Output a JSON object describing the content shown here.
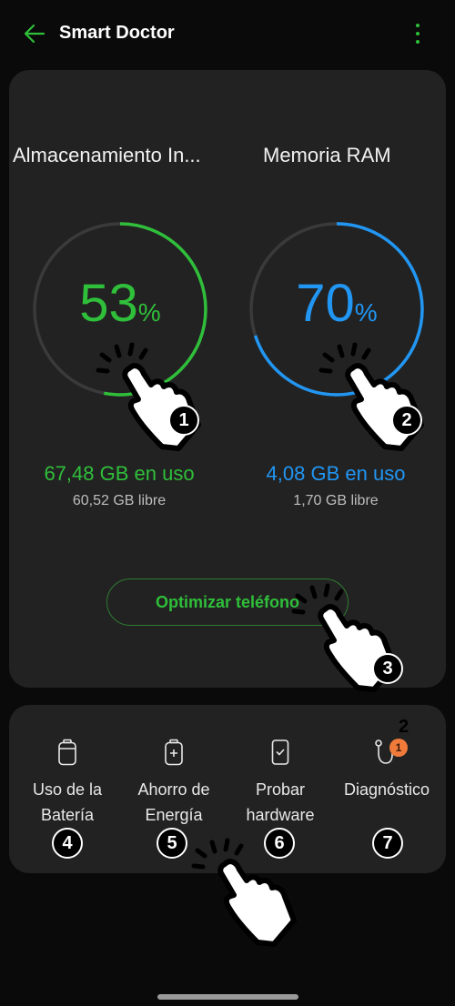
{
  "header": {
    "title": "Smart Doctor",
    "back_icon": "arrow-left-icon",
    "menu_icon": "more-vertical-icon"
  },
  "colors": {
    "accent_green": "#2fbf3a",
    "accent_blue": "#2196f3",
    "card_bg": "#222222",
    "page_bg": "#0a0a0a",
    "track": "#3a3a3a",
    "badge": "#f07a3a"
  },
  "storage": {
    "title": "Almacenamiento In...",
    "percent": "53",
    "percent_value": 53,
    "percent_symbol": "%",
    "used": "67,48 GB en uso",
    "free": "60,52 GB libre"
  },
  "ram": {
    "title": "Memoria RAM",
    "percent": "70",
    "percent_value": 70,
    "percent_symbol": "%",
    "used": "4,08 GB en uso",
    "free": "1,70 GB libre"
  },
  "optimize_button": "Optimizar teléfono",
  "tools": [
    {
      "label": "Uso de la Batería",
      "icon": "battery-icon"
    },
    {
      "label": "Ahorro de Energía",
      "icon": "battery-plus-icon"
    },
    {
      "label": "Probar hardware",
      "icon": "phone-check-icon"
    },
    {
      "label": "Diagnóstico",
      "icon": "stethoscope-icon",
      "badge": "1"
    }
  ],
  "annotations": {
    "n1": "1",
    "n2": "2",
    "n3": "3",
    "n4": "4",
    "n5": "5",
    "n6": "6",
    "n7": "7",
    "badge_note": "2"
  }
}
